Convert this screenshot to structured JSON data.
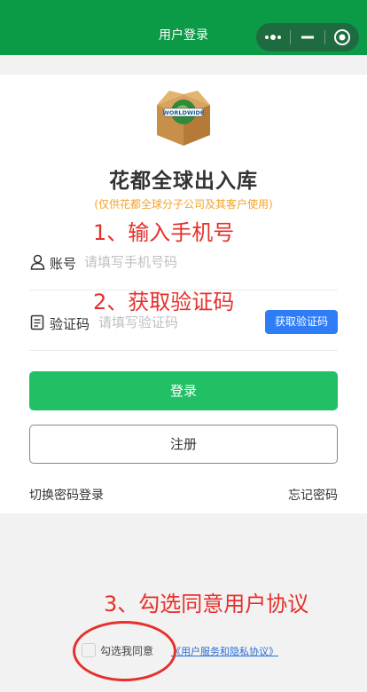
{
  "navbar": {
    "title": "用户登录",
    "icons": [
      "more-dots-icon",
      "minimize-icon",
      "close-target-icon"
    ],
    "background": "#0b9a46"
  },
  "header": {
    "logo_text": "WORLDWIDE",
    "title": "花都全球出入库",
    "subtitle": "(仅供花都全球分子公司及其客户使用)"
  },
  "form": {
    "account": {
      "label": "账号",
      "placeholder": "请填写手机号码",
      "value": "",
      "icon": "user-icon"
    },
    "code": {
      "label": "验证码",
      "placeholder": "请填写验证码",
      "value": "",
      "icon": "document-icon"
    },
    "get_code_button": "获取验证码",
    "login_button": "登录",
    "register_button": "注册",
    "switch_login": "切换密码登录",
    "forgot_password": "忘记密码"
  },
  "agreement": {
    "checkbox_label": "勾选我同意",
    "checked": false,
    "link_text": "《用户服务和隐私协议》"
  },
  "annotations": {
    "step1": "1、输入手机号",
    "step2": "2、获取验证码",
    "step3": "3、勾选同意用户协议",
    "color": "#e6302b"
  },
  "colors": {
    "primary_green": "#21c065",
    "accent_blue": "#2e7cf6",
    "subtitle_orange": "#f2a329",
    "link_blue": "#2a6fd6"
  }
}
